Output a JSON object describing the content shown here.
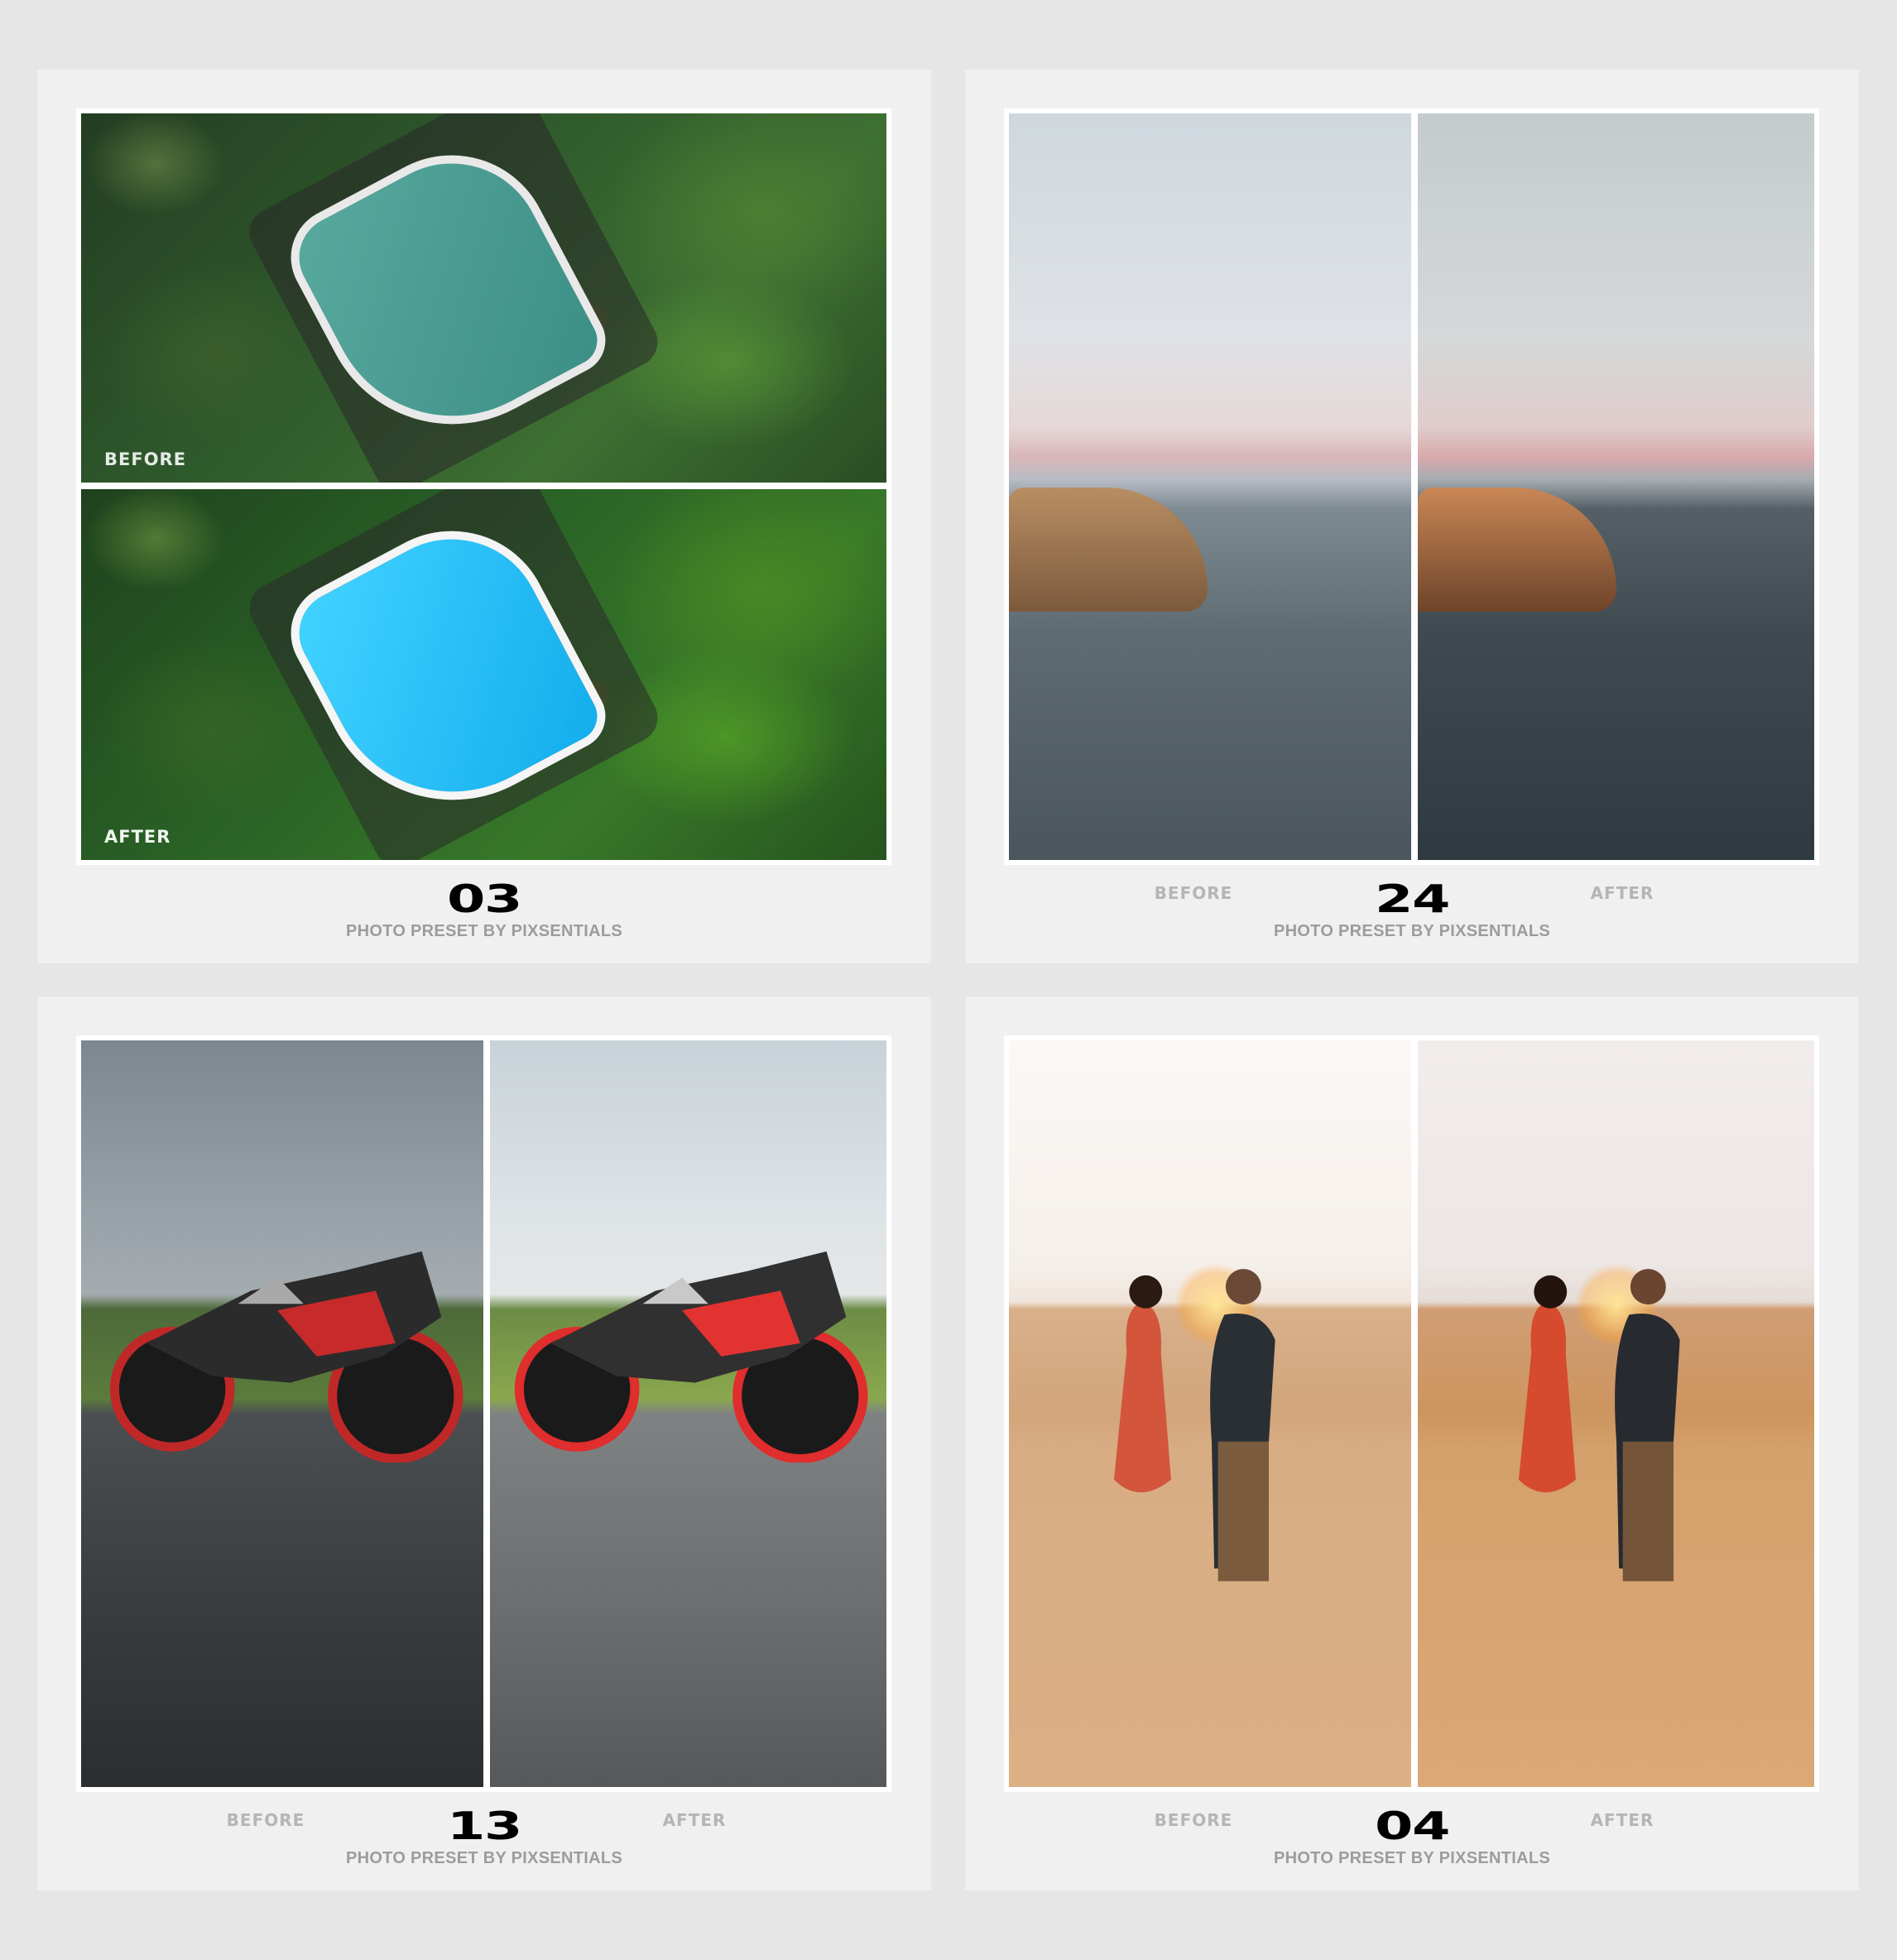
{
  "brand_line": "PHOTO PRESET BY PIXSENTIALS",
  "label_before": "BEFORE",
  "label_after": "AFTER",
  "cards": [
    {
      "number": "03",
      "subject": "aerial tropical pool"
    },
    {
      "number": "24",
      "subject": "coastal sunset"
    },
    {
      "number": "13",
      "subject": "sport motorcycle"
    },
    {
      "number": "04",
      "subject": "couple in desert dunes"
    }
  ],
  "colors": {
    "page_bg": "#e6e6e6",
    "card_bg": "#f0f0f0",
    "frame": "#ffffff",
    "number": "#000000",
    "brand_text": "#9c9c9c",
    "side_label": "#b5b5b5"
  }
}
